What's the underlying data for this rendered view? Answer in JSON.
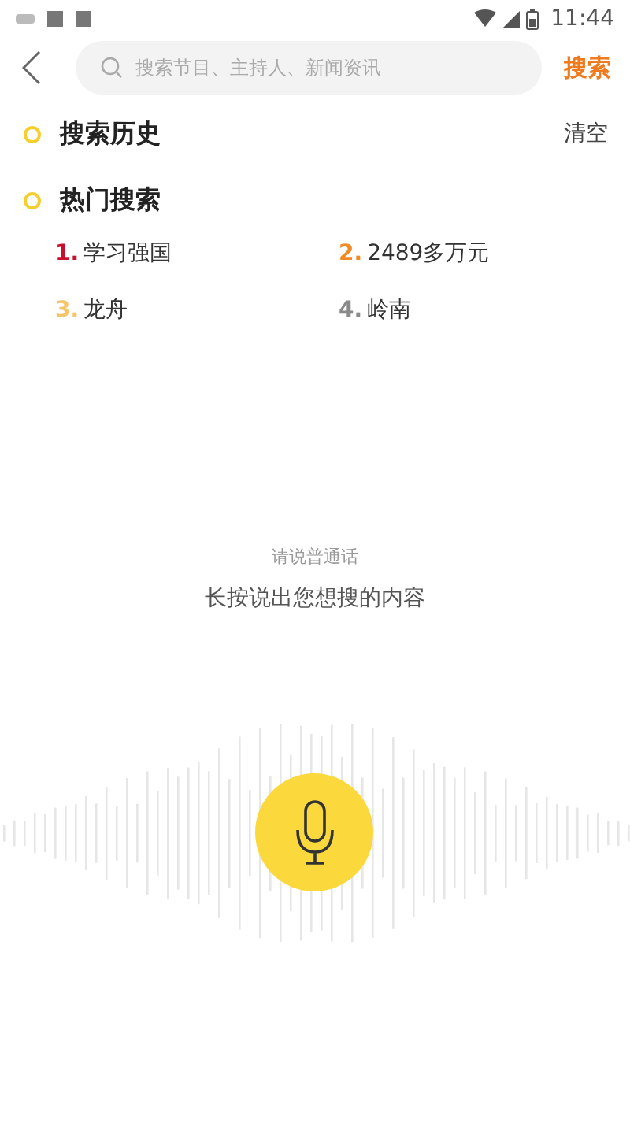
{
  "status_bar": {
    "time": "11:44"
  },
  "search": {
    "placeholder": "搜索节目、主持人、新闻资讯",
    "button": "搜索"
  },
  "history": {
    "title": "搜索历史",
    "clear": "清空"
  },
  "hot": {
    "title": "热门搜索",
    "items": [
      {
        "rank": "1.",
        "text": "学习强国",
        "color": "#c8102e"
      },
      {
        "rank": "2.",
        "text": "2489多万元",
        "color": "#f08a24"
      },
      {
        "rank": "3.",
        "text": "龙舟",
        "color": "#f5c56a"
      },
      {
        "rank": "4.",
        "text": "岭南",
        "color": "#8a8a8a"
      }
    ]
  },
  "voice": {
    "hint": "请说普通话",
    "prompt": "长按说出您想搜的内容"
  }
}
